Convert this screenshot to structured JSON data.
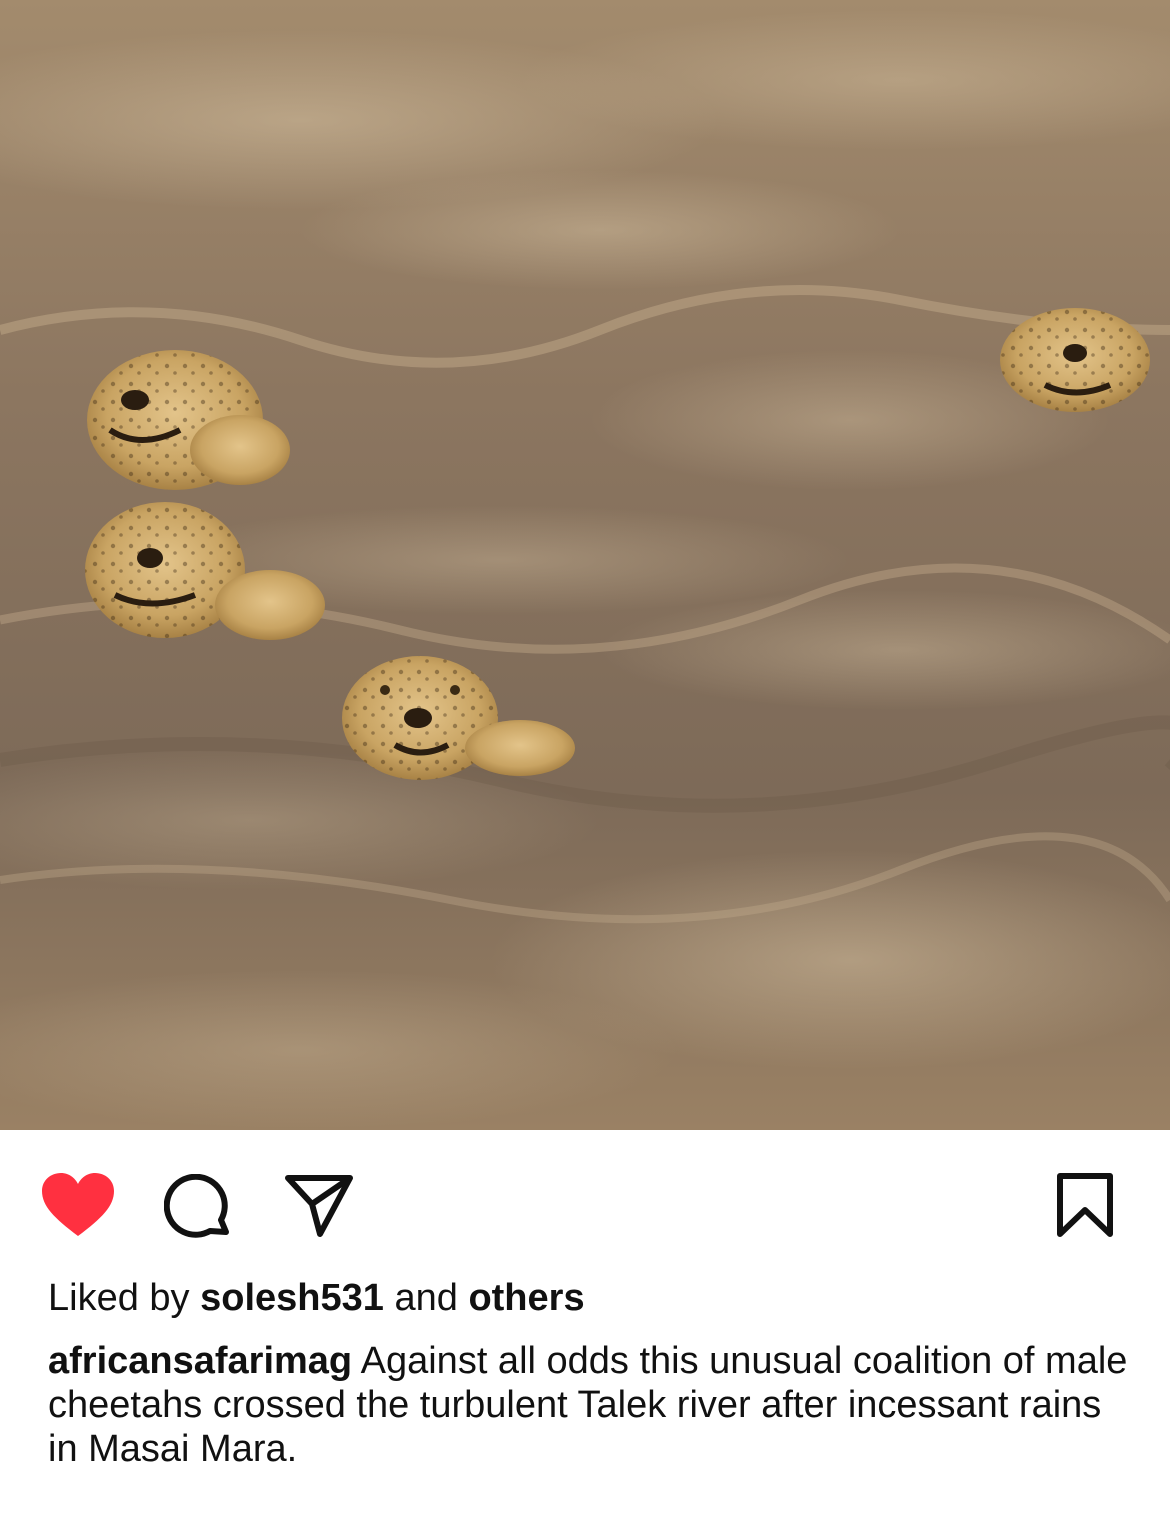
{
  "post": {
    "photo_icon": "cheetahs-crossing-river-photo",
    "actions": {
      "like_icon": "heart-filled-icon",
      "like_color": "#ff3040",
      "comment_icon": "comment-bubble-icon",
      "share_icon": "paper-plane-icon",
      "save_icon": "bookmark-icon"
    },
    "likes": {
      "prefix": "Liked by",
      "user": "solesh531",
      "connector": "and",
      "others": "others"
    },
    "caption": {
      "username": "africansafarimag",
      "text": "Against all odds this unusual coalition of male cheetahs crossed the turbulent Talek river after incessant rains in Masai Mara."
    }
  }
}
